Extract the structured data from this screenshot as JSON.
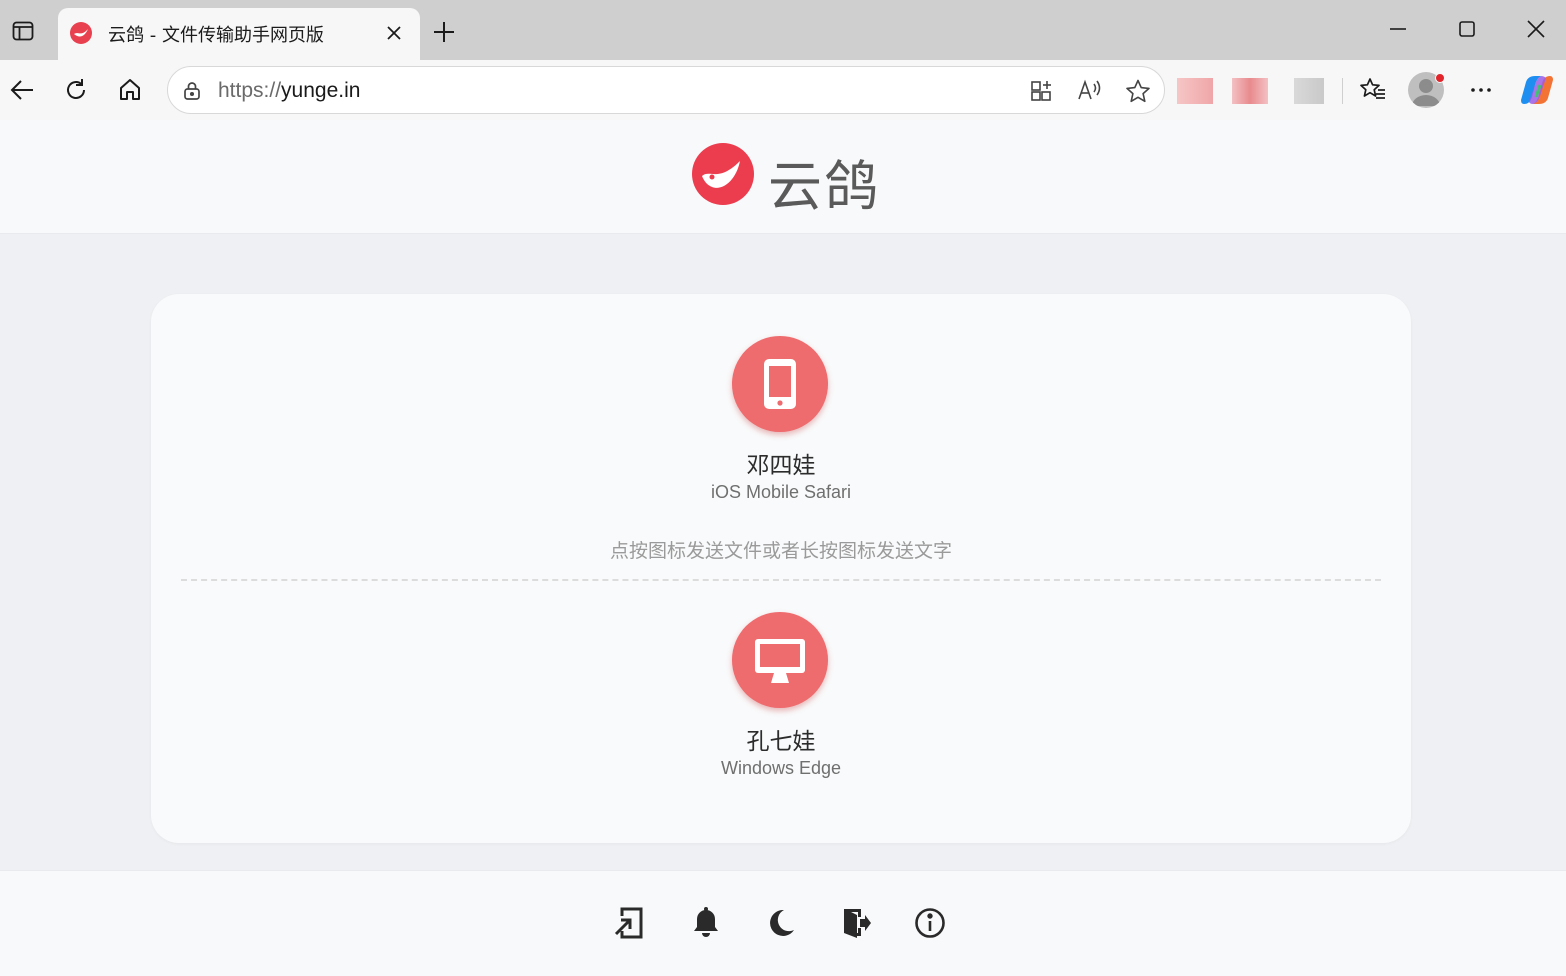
{
  "browser": {
    "tab": {
      "title": "云鸽 - 文件传输助手网页版"
    },
    "address": {
      "scheme": "https://",
      "host": "yunge.in"
    }
  },
  "app": {
    "logo_text": "云鸽",
    "brand_color": "#ee6b6e",
    "devices": [
      {
        "name": "邓四娃",
        "agent": "iOS Mobile Safari",
        "icon": "mobile-phone-icon"
      },
      {
        "name": "孔七娃",
        "agent": "Windows Edge",
        "icon": "desktop-monitor-icon"
      }
    ],
    "hint": "点按图标发送文件或者长按图标发送文字"
  },
  "footer": {
    "icons": [
      "enter-room-icon",
      "bell-icon",
      "moon-icon",
      "logout-icon",
      "info-icon"
    ]
  }
}
